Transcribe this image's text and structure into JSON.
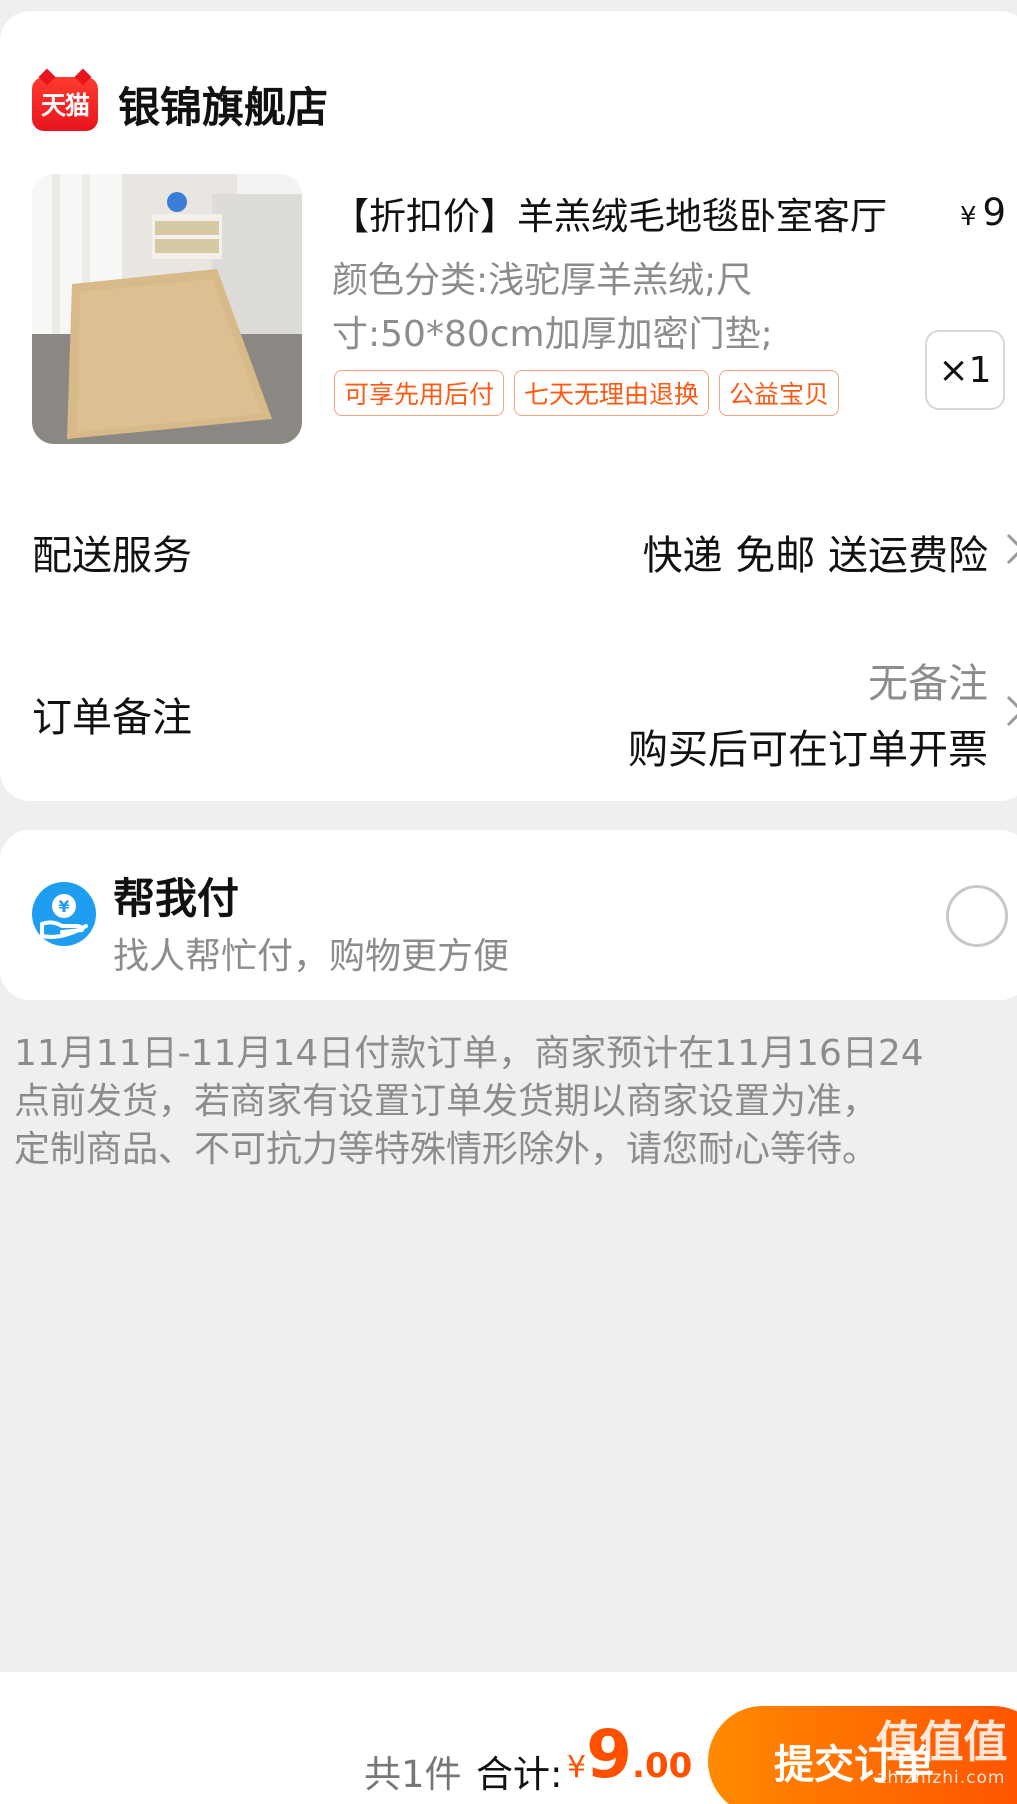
{
  "shop": {
    "logo_text": "天猫",
    "name": "银锦旗舰店"
  },
  "product": {
    "title": "【折扣价】羊羔绒毛地毯卧室客厅",
    "price_currency": "¥",
    "price_visible": "9",
    "spec_line1": "颜色分类:浅驼厚羊羔绒;尺",
    "spec_line2": "寸:50*80cm加厚加密门垫;",
    "tags": [
      "可享先用后付",
      "七天无理由退换",
      "公益宝贝"
    ],
    "quantity": "×1"
  },
  "delivery": {
    "label": "配送服务",
    "value": "快递 免邮 送运费险"
  },
  "note": {
    "label": "订单备注",
    "value": "无备注",
    "invoice": "购买后可在订单开票"
  },
  "help_pay": {
    "title": "帮我付",
    "subtitle": "找人帮忙付，购物更方便",
    "icon_symbol": "¥"
  },
  "notice": {
    "line1": "11月11日-11月14日付款订单，商家预计在11月16日24",
    "line2": "点前发货，若商家有设置订单发货期以商家设置为准，",
    "line3": "定制商品、不可抗力等特殊情形除外，请您耐心等待。"
  },
  "bottom": {
    "count": "共1件",
    "total_label": "合计:",
    "currency": "¥",
    "total_int": "9",
    "total_dec": ".00",
    "submit": "提交订单"
  },
  "watermark": {
    "big": "值值值",
    "small": "zhizhizhi.com"
  },
  "colors": {
    "accent_orange": "#ff5000",
    "tag_orange": "#ff5a14",
    "tmall_red": "#e8141e",
    "help_blue": "#1e9df1"
  },
  "icons": {
    "shop_logo": "tmall-logo",
    "row_chevron": "chevron-right-icon",
    "help_pay": "hand-yen-icon",
    "select": "radio-unchecked"
  }
}
